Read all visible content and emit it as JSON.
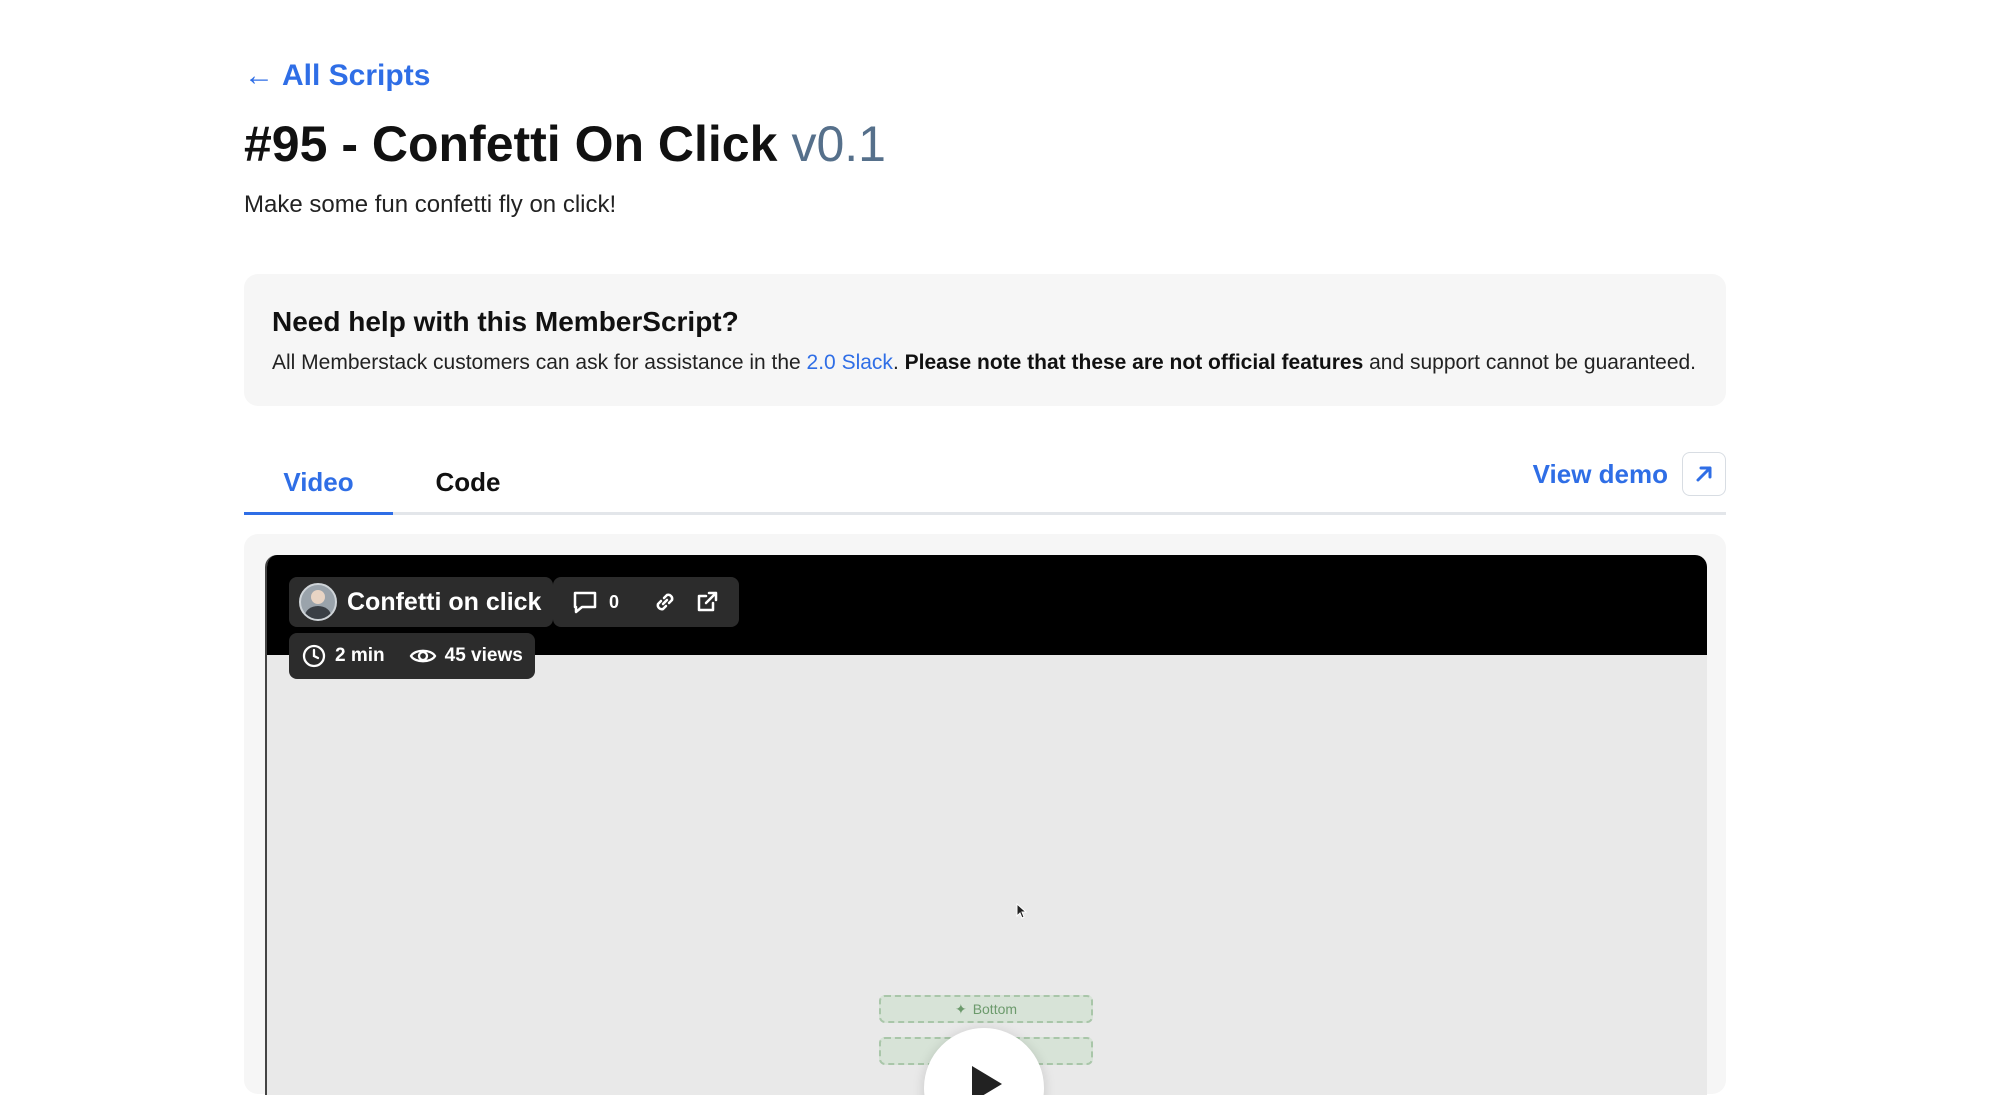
{
  "nav": {
    "back_arrow": "←",
    "back_label": "All Scripts"
  },
  "header": {
    "title": "#95 - Confetti On Click",
    "version": "v0.1",
    "description": "Make some fun confetti fly on click!"
  },
  "help": {
    "title": "Need help with this MemberScript?",
    "text_before": "All Memberstack customers can ask for assistance in the ",
    "link": "2.0 Slack",
    "text_mid": ". ",
    "bold": "Please note that these are not official features",
    "text_after": " and support cannot be guaranteed."
  },
  "tabs": [
    {
      "label": "Video",
      "active": true
    },
    {
      "label": "Code",
      "active": false
    }
  ],
  "view_demo": {
    "label": "View demo",
    "icon": "arrow-up-right-icon"
  },
  "video": {
    "title": "Confetti on click",
    "comments_count": "0",
    "duration": "2 min",
    "views": "45 views",
    "preview_buttons": [
      "Bottom",
      ""
    ]
  },
  "colors": {
    "accent": "#2f6ee6",
    "version": "#56708b",
    "panel": "#f6f6f6"
  }
}
